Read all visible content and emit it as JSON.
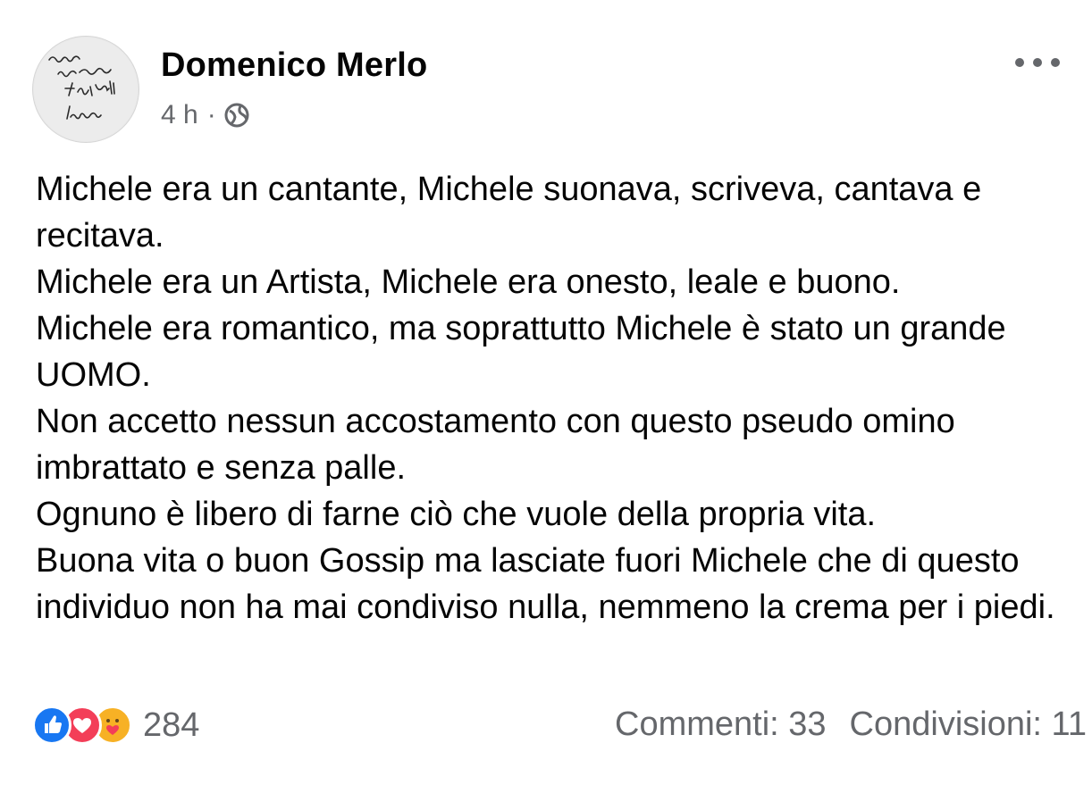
{
  "post": {
    "author": "Domenico Merlo",
    "time": "4 h",
    "separator": "·",
    "privacy_icon": "globe-icon",
    "avatar_icon": "handwritten-signature-avatar",
    "avatar_text": "Canta che passa tutto Lucio",
    "paragraphs": [
      "Michele era un cantante, Michele suonava, scriveva, cantava e recitava.",
      "Michele era un Artista, Michele era onesto, leale e buono.",
      "Michele era romantico, ma soprattutto Michele è stato un grande UOMO.",
      "Non accetto nessun accostamento con questo pseudo omino imbrattato e senza palle.",
      "Ognuno è libero di farne ciò che vuole della propria vita.",
      "Buona vita o buon Gossip ma lasciate fuori Michele che di questo individuo non ha mai condiviso nulla, nemmeno la crema per i piedi."
    ]
  },
  "footer": {
    "reaction_icons": [
      "like-icon",
      "love-icon",
      "care-icon"
    ],
    "reaction_count": "284",
    "comments": "Commenti: 33",
    "shares": "Condivisioni: 11"
  },
  "colors": {
    "text": "#050505",
    "secondary": "#65676b",
    "like": "#1877f2",
    "love": "#f33e58",
    "care": "#f7b125"
  }
}
